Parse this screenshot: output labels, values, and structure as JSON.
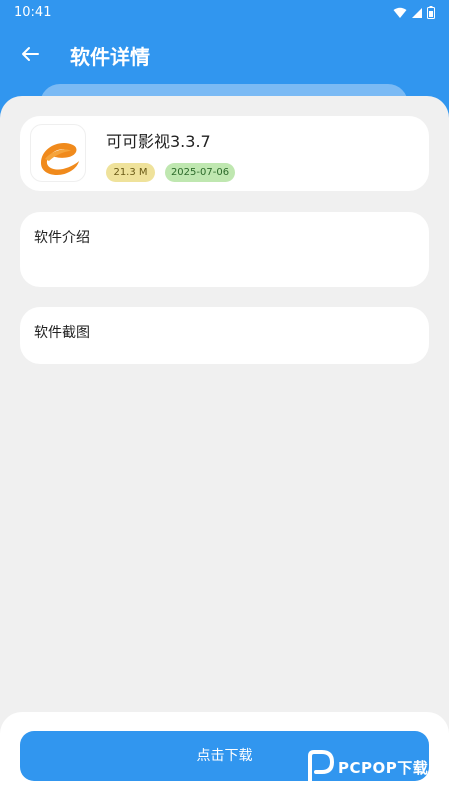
{
  "status_bar": {
    "time": "10:41",
    "icons": [
      "wifi-icon",
      "signal-icon",
      "battery-icon"
    ]
  },
  "app_bar": {
    "back_icon": "arrow-left-icon",
    "title": "软件详情"
  },
  "app_info": {
    "icon": "app-logo-icon",
    "name": "可可影视3.3.7",
    "size": "21.3 M",
    "date": "2025-07-06"
  },
  "sections": {
    "intro_label": "软件介绍",
    "screenshots_label": "软件截图"
  },
  "download": {
    "label": "点击下载"
  },
  "watermark": {
    "text": "PCPOP下载"
  },
  "colors": {
    "primary": "#3196ef",
    "background": "#f0f0f0",
    "size_tag": "#efe29b",
    "date_tag": "#bfe7b0",
    "logo_orange": "#f08a1c"
  }
}
